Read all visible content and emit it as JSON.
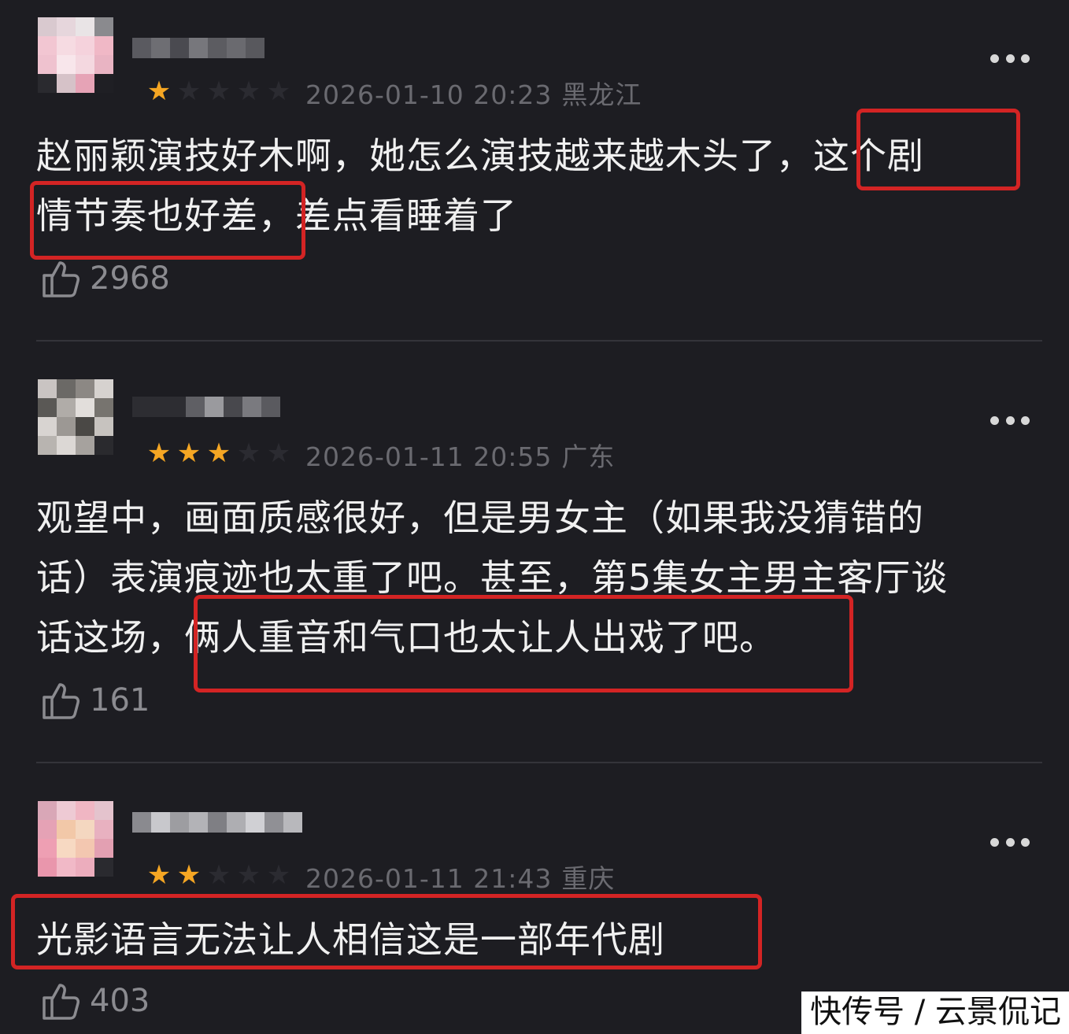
{
  "colors": {
    "background": "#1d1d22",
    "star_active": "#f5a623",
    "highlight_border": "#d32424",
    "meta_text": "#6a6a70"
  },
  "comments": [
    {
      "rating": 1,
      "datetime": "2026-01-10 20:23",
      "location": "黑龙江",
      "lines": [
        "赵丽颖演技好木啊，她怎么演技越来越木头了，这个剧",
        "情节奏也好差，差点看睡着了"
      ],
      "likes": "2968",
      "icon_like": "thumbs-up-icon",
      "icon_more": "more-dots-icon"
    },
    {
      "rating": 3,
      "datetime": "2026-01-11 20:55",
      "location": "广东",
      "lines": [
        "观望中，画面质感很好，但是男女主（如果我没猜错的",
        "话）表演痕迹也太重了吧。甚至，第5集女主男主客厅谈",
        "话这场，俩人重音和气口也太让人出戏了吧。"
      ],
      "likes": "161",
      "icon_like": "thumbs-up-icon",
      "icon_more": "more-dots-icon"
    },
    {
      "rating": 2,
      "datetime": "2026-01-11 21:43",
      "location": "重庆",
      "lines": [
        "光影语言无法让人相信这是一部年代剧"
      ],
      "likes": "403",
      "icon_like": "thumbs-up-icon",
      "icon_more": "more-dots-icon"
    }
  ],
  "watermark": "快传号 / 云景侃记"
}
